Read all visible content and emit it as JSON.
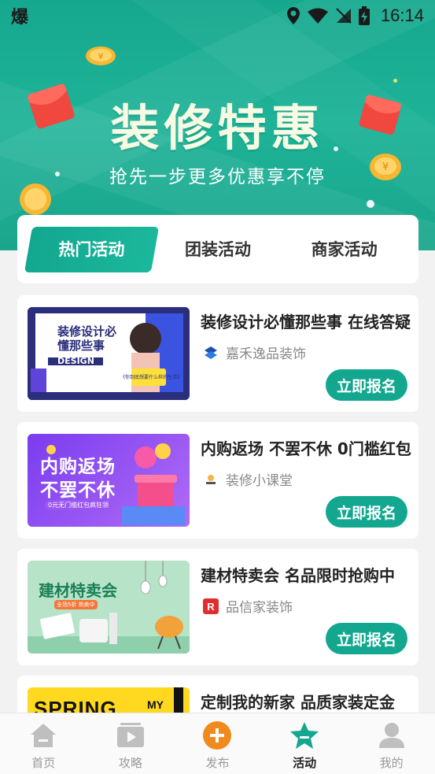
{
  "status_bar": {
    "left_glyph": "爆",
    "time": "16:14"
  },
  "hero": {
    "title": "装修特惠",
    "subtitle": "抢先一步更多优惠享不停"
  },
  "tabs": [
    {
      "label": "热门活动",
      "active": true
    },
    {
      "label": "团装活动",
      "active": false
    },
    {
      "label": "商家活动",
      "active": false
    }
  ],
  "activities": [
    {
      "title": "装修设计必懂那些事 在线答疑",
      "merchant": "嘉禾逸品装饰",
      "button": "立即报名",
      "thumb_text": {
        "line1": "装修设计必",
        "line2": "懂那些事",
        "line3": "DESIGN",
        "line4": "《你到底想要什么样的生活》"
      }
    },
    {
      "title": "内购返场 不罢不休 0门槛红包",
      "merchant": "装修小课堂",
      "button": "立即报名",
      "thumb_text": {
        "line1": "内购返场",
        "line2": "不罢不休",
        "line3": "0元无门槛红包疯狂领"
      }
    },
    {
      "title": "建材特卖会 名品限时抢购中",
      "merchant": "品信家装饰",
      "button": "立即报名",
      "thumb_text": {
        "line1": "建材特卖会",
        "line2": "全场5折 热卖中"
      }
    },
    {
      "title": "定制我的新家 品质家装定金",
      "merchant": "",
      "button": "",
      "thumb_text": {
        "line1": "SPRING",
        "line2": "MY"
      }
    }
  ],
  "bottom_nav": [
    {
      "label": "首页",
      "icon": "home-icon"
    },
    {
      "label": "攻略",
      "icon": "video-guide-icon"
    },
    {
      "label": "发布",
      "icon": "add-circle-icon"
    },
    {
      "label": "活动",
      "icon": "star-activity-icon",
      "active": true
    },
    {
      "label": "我的",
      "icon": "user-icon"
    }
  ],
  "colors": {
    "brand": "#13a78f",
    "publish": "#f08a1c"
  }
}
